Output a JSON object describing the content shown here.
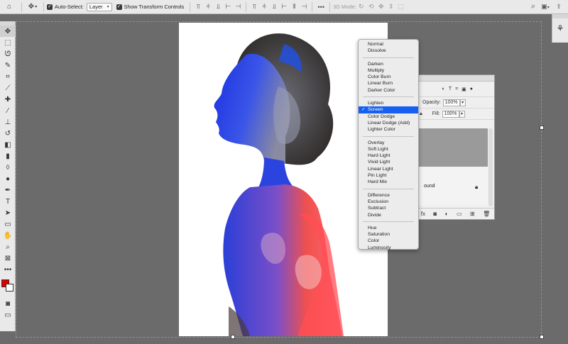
{
  "options_bar": {
    "home_icon": "home-icon",
    "move_tool_icon": "move-icon",
    "auto_select_label": "Auto-Select:",
    "auto_select_target": "Layer",
    "show_transform_label": "Show Transform Controls",
    "more_label": "•••",
    "mode_3d_label": "3D Mode:",
    "search_icon": "search-icon"
  },
  "toolbar": {
    "tools": [
      {
        "name": "move-tool",
        "glyph": "✥"
      },
      {
        "name": "marquee-tool",
        "glyph": "⬚"
      },
      {
        "name": "lasso-tool",
        "glyph": "ᘎ"
      },
      {
        "name": "quick-select-tool",
        "glyph": "✎"
      },
      {
        "name": "crop-tool",
        "glyph": "⌗"
      },
      {
        "name": "eyedropper-tool",
        "glyph": "⟋"
      },
      {
        "name": "healing-brush-tool",
        "glyph": "✚"
      },
      {
        "name": "brush-tool",
        "glyph": "⁄"
      },
      {
        "name": "clone-stamp-tool",
        "glyph": "⊥"
      },
      {
        "name": "history-brush-tool",
        "glyph": "↺"
      },
      {
        "name": "eraser-tool",
        "glyph": "◧"
      },
      {
        "name": "gradient-tool",
        "glyph": "▮"
      },
      {
        "name": "blur-tool",
        "glyph": "◊"
      },
      {
        "name": "dodge-tool",
        "glyph": "●"
      },
      {
        "name": "pen-tool",
        "glyph": "✒"
      },
      {
        "name": "type-tool",
        "glyph": "T"
      },
      {
        "name": "path-select-tool",
        "glyph": "➤"
      },
      {
        "name": "shape-tool",
        "glyph": "▭"
      },
      {
        "name": "hand-tool",
        "glyph": "✋"
      },
      {
        "name": "zoom-tool",
        "glyph": "⌕"
      },
      {
        "name": "edit-toolbar",
        "glyph": "⊠"
      },
      {
        "name": "more-tools",
        "glyph": "•••"
      }
    ],
    "foreground_color": "#e00000",
    "background_color": "#ffffff"
  },
  "layers_panel": {
    "opacity_label": "Opacity:",
    "opacity_value": "100%",
    "fill_label": "Fill:",
    "fill_value": "100%",
    "background_layer_name": "ound"
  },
  "blend_menu": {
    "selected": "Screen",
    "groups": [
      [
        "Normal",
        "Dissolve"
      ],
      [
        "Darken",
        "Multiply",
        "Color Burn",
        "Linear Burn",
        "Darker Color"
      ],
      [
        "Lighten",
        "Screen",
        "Color Dodge",
        "Linear Dodge (Add)",
        "Lighter Color"
      ],
      [
        "Overlay",
        "Soft Light",
        "Hard Light",
        "Vivid Light",
        "Linear Light",
        "Pin Light",
        "Hard Mix"
      ],
      [
        "Difference",
        "Exclusion",
        "Subtract",
        "Divide"
      ],
      [
        "Hue",
        "Saturation",
        "Color",
        "Luminosity"
      ]
    ]
  },
  "colors": {
    "selection_blue": "#1560f0",
    "workspace_gray": "#6b6b6b"
  }
}
